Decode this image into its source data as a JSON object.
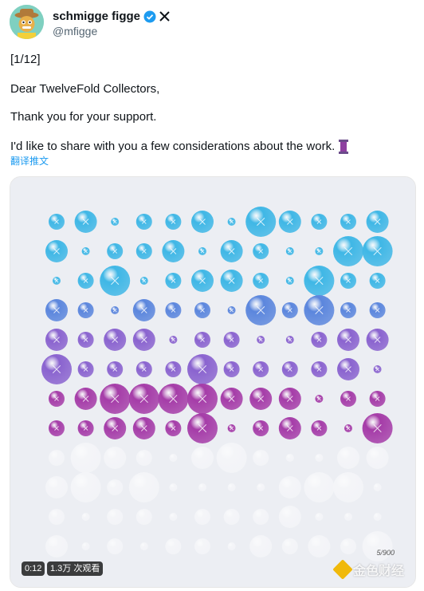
{
  "author": {
    "name": "schmigge figge",
    "handle": "@mfigge"
  },
  "tweet": {
    "lines": [
      "[1/12]",
      "Dear TwelveFold Collectors,",
      "Thank you for your support.",
      "I'd like to share with you a few considerations about the work."
    ],
    "translate_label": "翻译推文"
  },
  "media": {
    "duration": "0:12",
    "views": "1.3万 次观看",
    "signature": "5/900",
    "watermark": "金色财经"
  },
  "colors": {
    "accent": "#1d9bf0",
    "cyan": "#3fb7e6",
    "blue": "#5b86dd",
    "violet": "#8a63cf",
    "magenta": "#a53ca8",
    "white": "#f4f5f8"
  }
}
